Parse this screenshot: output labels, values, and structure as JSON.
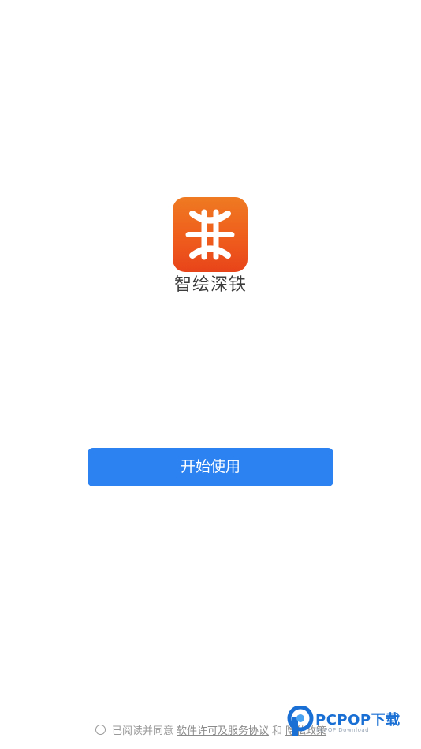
{
  "app": {
    "icon": "metro-logo-icon",
    "name": "智绘深铁",
    "icon_gradient": [
      "#ef7a22",
      "#e8441a"
    ]
  },
  "actions": {
    "start_label": "开始使用",
    "start_color": "#2b82f0"
  },
  "agreement": {
    "prefix": "已阅读并同意",
    "license_link": "软件许可及服务协议",
    "conjunction": "和",
    "privacy_link": "隐私政策",
    "checked": false
  },
  "watermark": {
    "title": "PCPOP下载",
    "subtitle": "PCPOP Download"
  }
}
